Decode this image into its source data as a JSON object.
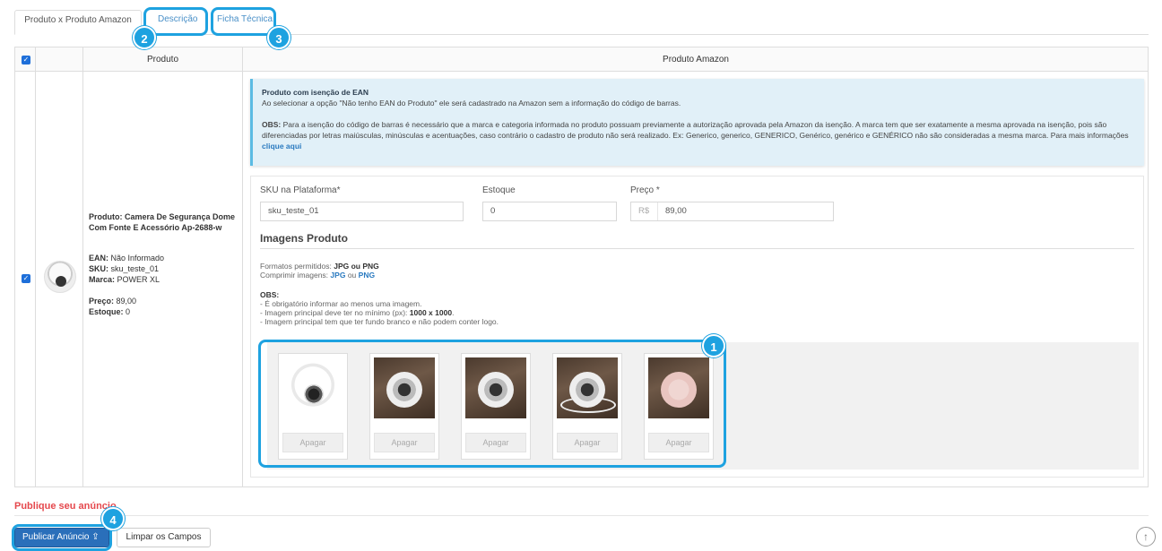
{
  "tabs": [
    {
      "label": "Produto x Produto Amazon",
      "active": true
    },
    {
      "label": "Descrição",
      "active": false
    },
    {
      "label": "Ficha Técnica",
      "active": false
    }
  ],
  "badges": [
    "1",
    "2",
    "3",
    "4"
  ],
  "table": {
    "headers": {
      "produto": "Produto",
      "produto_amazon": "Produto Amazon"
    },
    "checkbox_checked": true
  },
  "product": {
    "title": "Produto: Camera De Segurança Dome Com Fonte E Acessório Ap-2688-w",
    "ean_label": "EAN:",
    "ean_value": "Não Informado",
    "sku_label": "SKU:",
    "sku_value": "sku_teste_01",
    "marca_label": "Marca:",
    "marca_value": "POWER XL",
    "preco_label": "Preço:",
    "preco_value": "89,00",
    "estoque_label": "Estoque:",
    "estoque_value": "0"
  },
  "info": {
    "title": "Produto com isenção de EAN",
    "line1": "Ao selecionar a opção \"Não tenho EAN do Produto\" ele será cadastrado na Amazon sem a informação do código de barras.",
    "obs_label": "OBS:",
    "obs_text": "Para a isenção do código de barras é necessário que a marca e categoria informada no produto possuam previamente a autorização aprovada pela Amazon da isenção. A marca tem que ser exatamente a mesma aprovada na isenção, pois são diferenciadas por letras maiúsculas, minúsculas e acentuações, caso contrário o cadastro de produto não será realizado. Ex: Generico, generico, GENERICO, Genérico, genérico e GENÉRICO não são consideradas a mesma marca. Para mais informações",
    "link": "clique aqui"
  },
  "form": {
    "sku_label": "SKU na Plataforma*",
    "sku_value": "sku_teste_01",
    "estoque_label": "Estoque",
    "estoque_value": "0",
    "preco_label": "Preço *",
    "preco_prefix": "R$",
    "preco_value": "89,00"
  },
  "images": {
    "section_title": "Imagens Produto",
    "formatos_label": "Formatos permitidos:",
    "formatos_value": "JPG ou PNG",
    "comprimir_label": "Comprimir imagens:",
    "comprimir_jpg": "JPG",
    "comprimir_ou": "ou",
    "comprimir_png": "PNG",
    "obs_label": "OBS:",
    "obs1": "- É obrigatório informar ao menos uma imagem.",
    "obs2_prefix": "- Imagem principal deve ter no mínimo (px):",
    "obs2_value": "1000 x 1000",
    "obs3": "- Imagem principal tem que ter fundo branco e não podem conter logo.",
    "delete_label": "Apagar",
    "count": 5
  },
  "footer": {
    "publish_title": "Publique seu anúncio",
    "publish_button": "Publicar Anúncio",
    "clear_button": "Limpar os Campos",
    "scroll_top_icon": "arrow-up-circle-icon"
  },
  "colors": {
    "highlight": "#1ea2e0",
    "primary": "#2a6fba",
    "publish_title": "#e5484d"
  }
}
